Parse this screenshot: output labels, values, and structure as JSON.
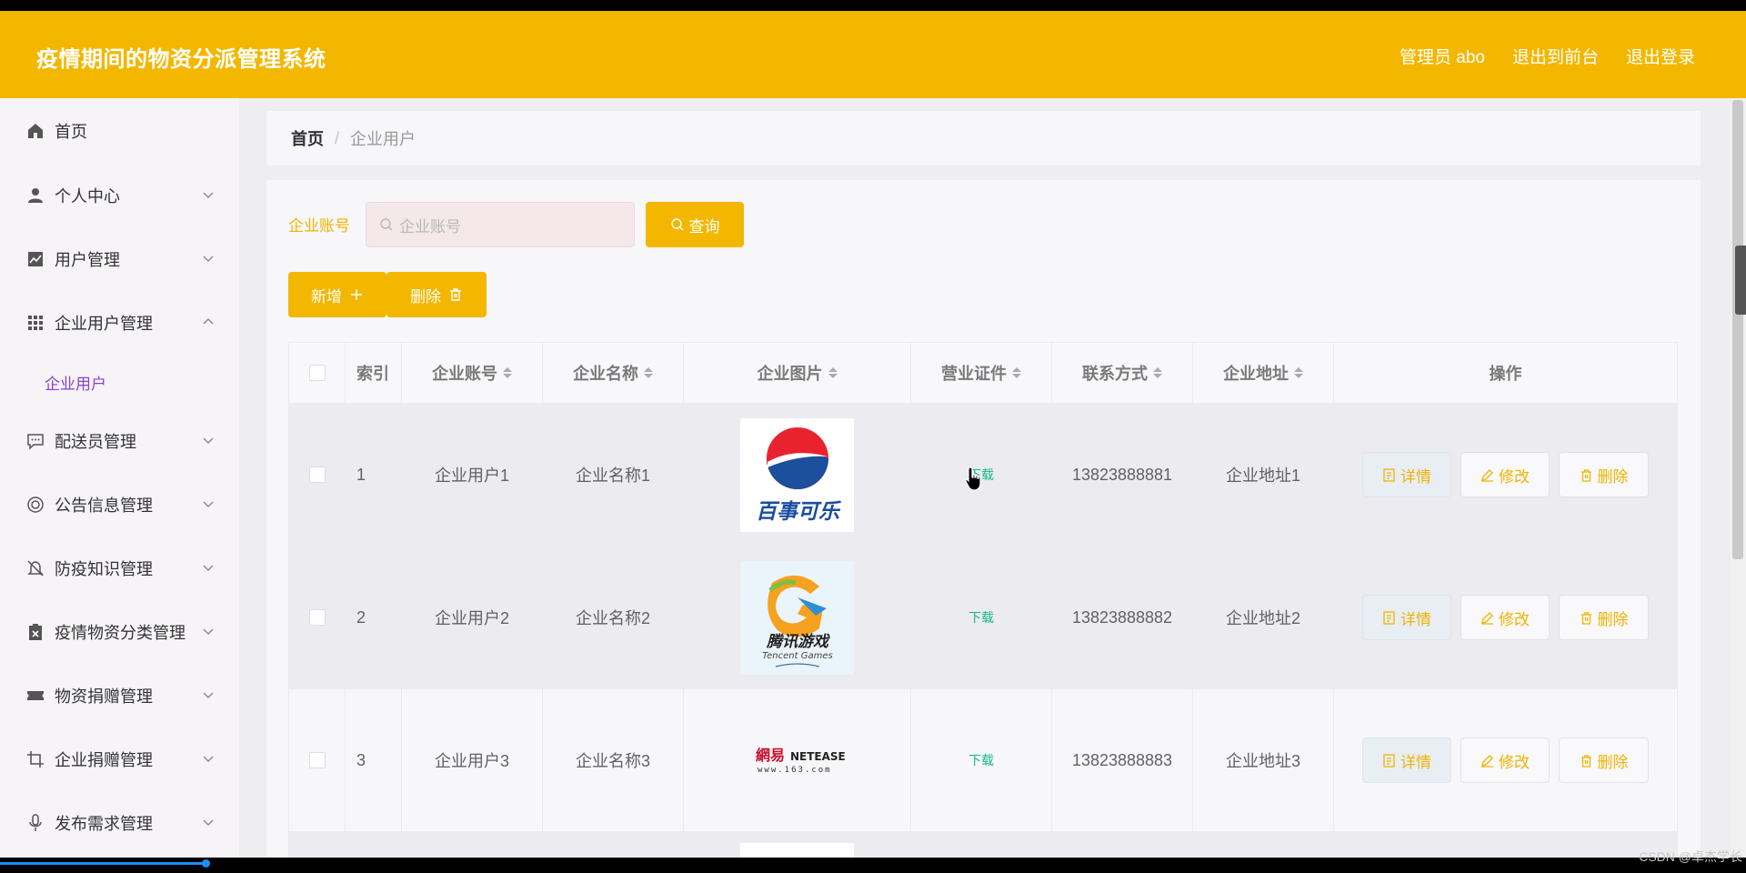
{
  "header": {
    "title": "疫情期间的物资分派管理系统",
    "admin_label": "管理员 abo",
    "to_front_label": "退出到前台",
    "logout_label": "退出登录",
    "color": "#f3b700"
  },
  "sidebar": {
    "items": [
      {
        "label": "首页",
        "icon": "home-icon"
      },
      {
        "label": "个人中心",
        "icon": "user-icon"
      },
      {
        "label": "用户管理",
        "icon": "chart-icon"
      },
      {
        "label": "企业用户管理",
        "icon": "grid-icon",
        "expanded": true
      },
      {
        "label": "配送员管理",
        "icon": "message-icon"
      },
      {
        "label": "公告信息管理",
        "icon": "lifebuoy-icon"
      },
      {
        "label": "防疫知识管理",
        "icon": "bell-off-icon"
      },
      {
        "label": "疫情物资分类管理",
        "icon": "clipboard-icon"
      },
      {
        "label": "物资捐赠管理",
        "icon": "ticket-icon"
      },
      {
        "label": "企业捐赠管理",
        "icon": "crop-icon"
      },
      {
        "label": "发布需求管理",
        "icon": "microphone-icon"
      }
    ],
    "submenu_active": "企业用户",
    "active_color": "#8a3fd4"
  },
  "breadcrumb": {
    "home": "首页",
    "separator": "/",
    "current": "企业用户"
  },
  "search": {
    "label": "企业账号",
    "placeholder": "企业账号",
    "button": "查询"
  },
  "actions": {
    "add": "新增",
    "delete": "删除"
  },
  "table": {
    "columns": [
      "索引",
      "企业账号",
      "企业名称",
      "企业图片",
      "营业证件",
      "联系方式",
      "企业地址",
      "操作"
    ],
    "rows": [
      {
        "index": "1",
        "account": "企业用户1",
        "name": "企业名称1",
        "logo": "pepsi-logo",
        "logo_text": "百事可乐",
        "license": "下载",
        "phone": "13823888881",
        "address": "企业地址1"
      },
      {
        "index": "2",
        "account": "企业用户2",
        "name": "企业名称2",
        "logo": "tencent-games-logo",
        "logo_text": "腾讯游戏",
        "logo_sub": "Tencent Games",
        "license": "下载",
        "phone": "13823888882",
        "address": "企业地址2"
      },
      {
        "index": "3",
        "account": "企业用户3",
        "name": "企业名称3",
        "logo": "netease-logo",
        "logo_text": "網易",
        "logo_brand": "NETEASE",
        "logo_sub": "www.163.com",
        "license": "下载",
        "phone": "13823888883",
        "address": "企业地址3"
      }
    ],
    "op_labels": {
      "detail": "详情",
      "edit": "修改",
      "remove": "删除"
    },
    "download_color": "#13b98a"
  },
  "watermark": "CSDN @卓杰学长"
}
